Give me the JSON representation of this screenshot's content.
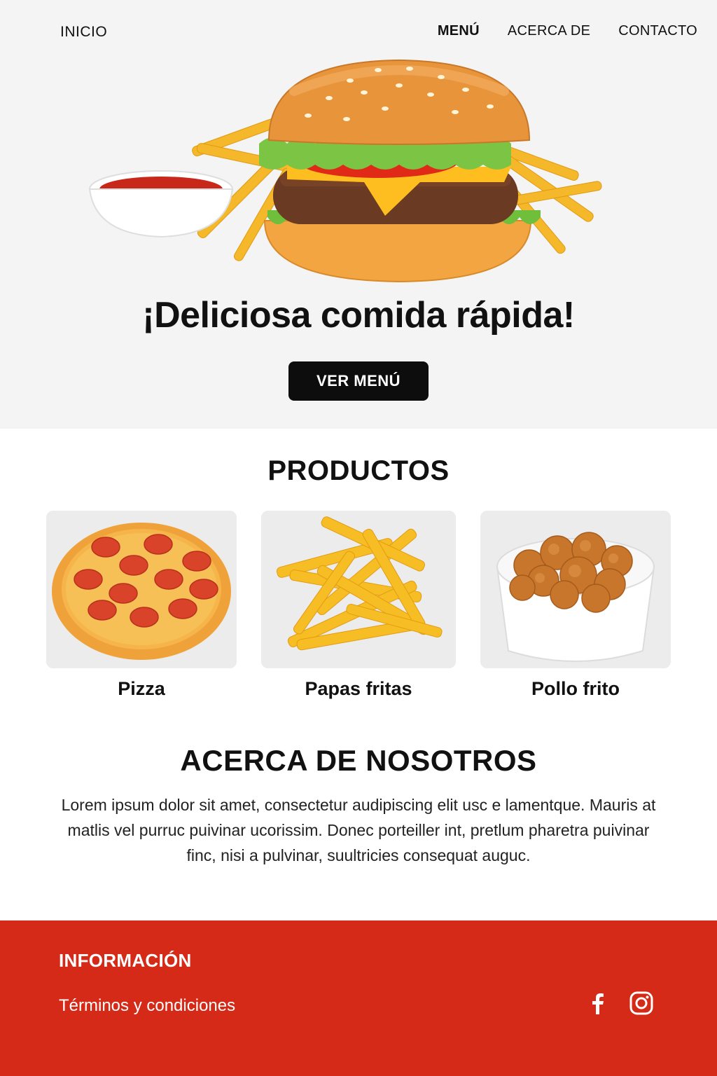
{
  "nav": {
    "home": "INICIO",
    "items": [
      "MENÚ",
      "ACERCA DE",
      "CONTACTO"
    ]
  },
  "hero": {
    "title": "¡Deliciosa comida rápida!",
    "button": "VER MENÚ"
  },
  "products": {
    "title": "PRODUCTOS",
    "items": [
      {
        "name": "Pizza",
        "icon": "pizza-image"
      },
      {
        "name": "Papas fritas",
        "icon": "fries-image"
      },
      {
        "name": "Pollo frito",
        "icon": "fried-chicken-image"
      }
    ]
  },
  "about": {
    "title": "ACERCA DE NOSOTROS",
    "text": "Lorem ipsum dolor sit amet, consectetur audipiscing elit usc e lamentque. Mauris at matlis vel purruc puivinar ucorissim. Donec porteiller int, pretlum pharetra puivinar finc, nisi a pulvinar, suultricies consequat auguc."
  },
  "footer": {
    "title": "INFORMACIÓN",
    "link": "Términos y condiciones",
    "social": [
      "facebook-icon",
      "instagram-icon"
    ]
  },
  "colors": {
    "accent": "#d42a17",
    "button": "#0d0d0d",
    "hero_bg": "#f4f4f4"
  }
}
